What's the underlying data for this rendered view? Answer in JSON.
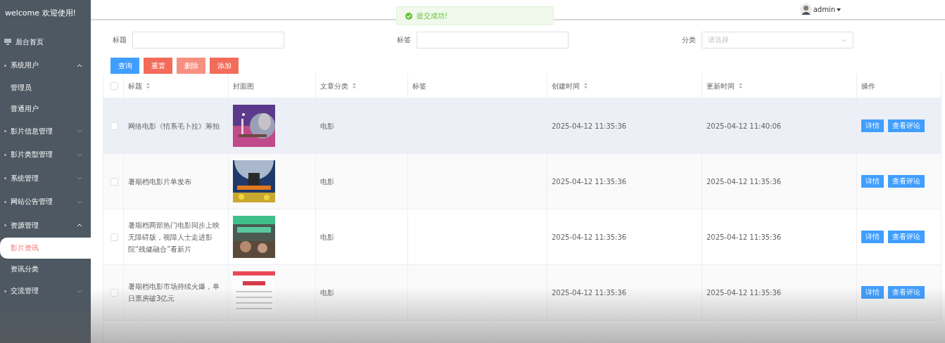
{
  "sidebar": {
    "welcome": "welcome 欢迎使用!",
    "items": [
      {
        "kind": "home",
        "label": "后台首页"
      },
      {
        "kind": "group",
        "label": "系统用户",
        "expanded": true,
        "children": [
          {
            "label": "管理员",
            "selected": false
          },
          {
            "label": "普通用户",
            "selected": false
          }
        ]
      },
      {
        "kind": "group",
        "label": "影片信息管理",
        "expanded": false
      },
      {
        "kind": "group",
        "label": "影片类型管理",
        "expanded": false
      },
      {
        "kind": "group",
        "label": "系统管理",
        "expanded": false
      },
      {
        "kind": "group",
        "label": "网站公告管理",
        "expanded": false
      },
      {
        "kind": "group",
        "label": "资源管理",
        "expanded": true,
        "children": [
          {
            "label": "影片资讯",
            "selected": true
          },
          {
            "label": "资讯分类",
            "selected": false
          }
        ]
      },
      {
        "kind": "group",
        "label": "交流管理",
        "expanded": false
      }
    ]
  },
  "header": {
    "user": "admin"
  },
  "toast": {
    "message": "提交成功!"
  },
  "filters": [
    {
      "label": "标题",
      "kind": "input"
    },
    {
      "label": "标签",
      "kind": "input"
    },
    {
      "label": "分类",
      "kind": "select",
      "placeholder": "请选择"
    }
  ],
  "actions": [
    {
      "label": "查询",
      "kind": "primary"
    },
    {
      "label": "重置",
      "kind": "danger"
    },
    {
      "label": "删除",
      "kind": "muted"
    },
    {
      "label": "添加",
      "kind": "danger"
    }
  ],
  "table": {
    "select_all_checked": false,
    "columns": [
      {
        "label": "标题",
        "sortable": true
      },
      {
        "label": "封面图",
        "sortable": false
      },
      {
        "label": "文章分类",
        "sortable": true
      },
      {
        "label": "标签",
        "sortable": false
      },
      {
        "label": "创建时间",
        "sortable": true
      },
      {
        "label": "更新时间",
        "sortable": true
      },
      {
        "label": "操作",
        "sortable": false
      }
    ],
    "rows": [
      {
        "title": "网络电影《情系毛卜拉》筹拍",
        "cover": {
          "kind": "picture"
        },
        "category": "电影",
        "created": "2025-04-12 11:35:36",
        "updated": "2025-04-12 11:40:06",
        "hovered": true,
        "checked": false,
        "buttons": [
          "详情",
          "查看评论"
        ]
      },
      {
        "title": "暑期档电影片单发布",
        "cover": {
          "kind": "picture"
        },
        "category": "电影",
        "created": "2025-04-12 11:35:36",
        "updated": "2025-04-12 11:35:36",
        "hovered": false,
        "checked": false,
        "buttons": [
          "详情",
          "查看评论"
        ]
      },
      {
        "title": "暑期档两部热门电影同步上映无障碍版，视障人士走进影院“残健融合”看新片",
        "cover": {
          "kind": "picture"
        },
        "category": "电影",
        "created": "2025-04-12 11:35:36",
        "updated": "2025-04-12 11:35:36",
        "hovered": false,
        "checked": false,
        "buttons": [
          "详情",
          "查看评论"
        ]
      },
      {
        "title": "暑期档电影市场持续火爆，单日票房破3亿元",
        "cover": {
          "kind": "picture"
        },
        "category": "电影",
        "created": "2025-04-12 11:35:36",
        "updated": "2025-04-12 11:35:36",
        "hovered": false,
        "checked": false,
        "buttons": [
          "详情",
          "查看评论"
        ]
      }
    ]
  }
}
